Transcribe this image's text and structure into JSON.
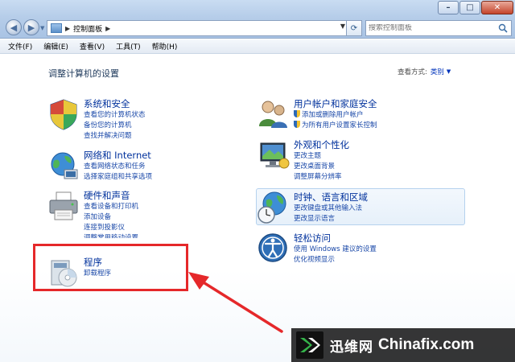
{
  "address": {
    "crumb": "控制面板"
  },
  "search": {
    "placeholder": "搜索控制面板"
  },
  "menu": [
    "文件(F)",
    "编辑(E)",
    "查看(V)",
    "工具(T)",
    "帮助(H)"
  ],
  "heading": "调整计算机的设置",
  "view_by": {
    "label": "查看方式:",
    "value": "类别"
  },
  "categories": [
    {
      "title": "系统和安全",
      "links": [
        "查看您的计算机状态",
        "备份您的计算机",
        "查找并解决问题"
      ]
    },
    {
      "title": "网络和 Internet",
      "links": [
        "查看网络状态和任务",
        "选择家庭组和共享选项"
      ]
    },
    {
      "title": "硬件和声音",
      "links": [
        "查看设备和打印机",
        "添加设备",
        "连接到投影仪",
        "调整常用移动设置"
      ]
    },
    {
      "title": "程序",
      "links": [
        "卸载程序"
      ]
    },
    {
      "title": "用户帐户和家庭安全",
      "links": [
        "添加或删除用户帐户",
        "为所有用户设置家长控制"
      ]
    },
    {
      "title": "外观和个性化",
      "links": [
        "更改主题",
        "更改桌面背景",
        "调整屏幕分辨率"
      ]
    },
    {
      "title": "时钟、语言和区域",
      "links": [
        "更改键盘或其他输入法",
        "更改显示语言"
      ]
    },
    {
      "title": "轻松访问",
      "links": [
        "使用 Windows 建议的设置",
        "优化视频显示"
      ]
    }
  ],
  "watermark": {
    "brand": "迅维网",
    "site": "Chinafix.com"
  },
  "colors": {
    "accent": "#00319c",
    "link": "#1a48a8",
    "highlight_box": "#e5282a",
    "arrow": "#e5282a"
  }
}
